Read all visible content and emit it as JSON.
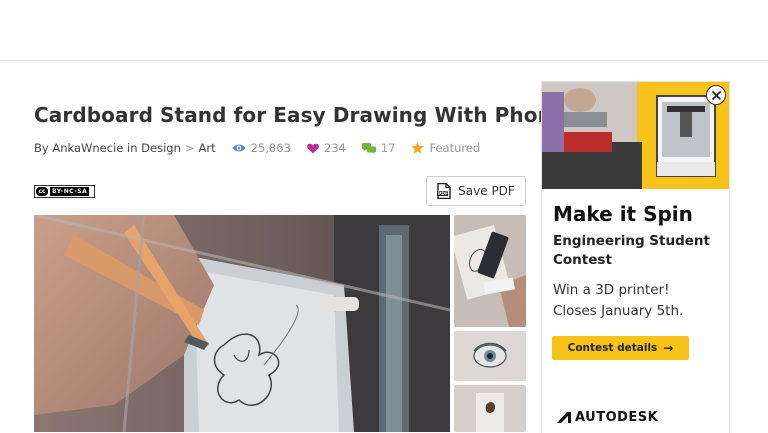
{
  "article": {
    "title": "Cardboard Stand for Easy Drawing With Phone",
    "by_prefix": "By",
    "author": "AnkaWnecie",
    "in_word": "in",
    "category": "Design",
    "breadcrumb_sep": ">",
    "subcategory": "Art",
    "views": "25,863",
    "favorites": "234",
    "comments": "17",
    "featured": "Featured",
    "license_cc": "cc",
    "license_text": "BY-NC-SA",
    "save_pdf_label": "Save PDF"
  },
  "ad": {
    "headline": "Make it Spin",
    "subheadline": "Engineering Student Contest",
    "body_line1": "Win a 3D printer!",
    "body_line2": "Closes January 5th.",
    "button_label": "Contest details",
    "brand": "AUTODESK"
  },
  "colors": {
    "views_icon": "#5b7fc4",
    "favorites_icon": "#c4299a",
    "comments_icon": "#6fb33a",
    "featured_icon": "#f0a821",
    "ad_accent": "#f7c21a"
  },
  "icons": {
    "views": "eye-icon",
    "favorites": "heart-icon",
    "comments": "comment-bubbles-icon",
    "featured": "star-icon",
    "save_pdf": "pdf-document-icon",
    "close": "close-icon",
    "brand": "autodesk-logo-icon"
  }
}
